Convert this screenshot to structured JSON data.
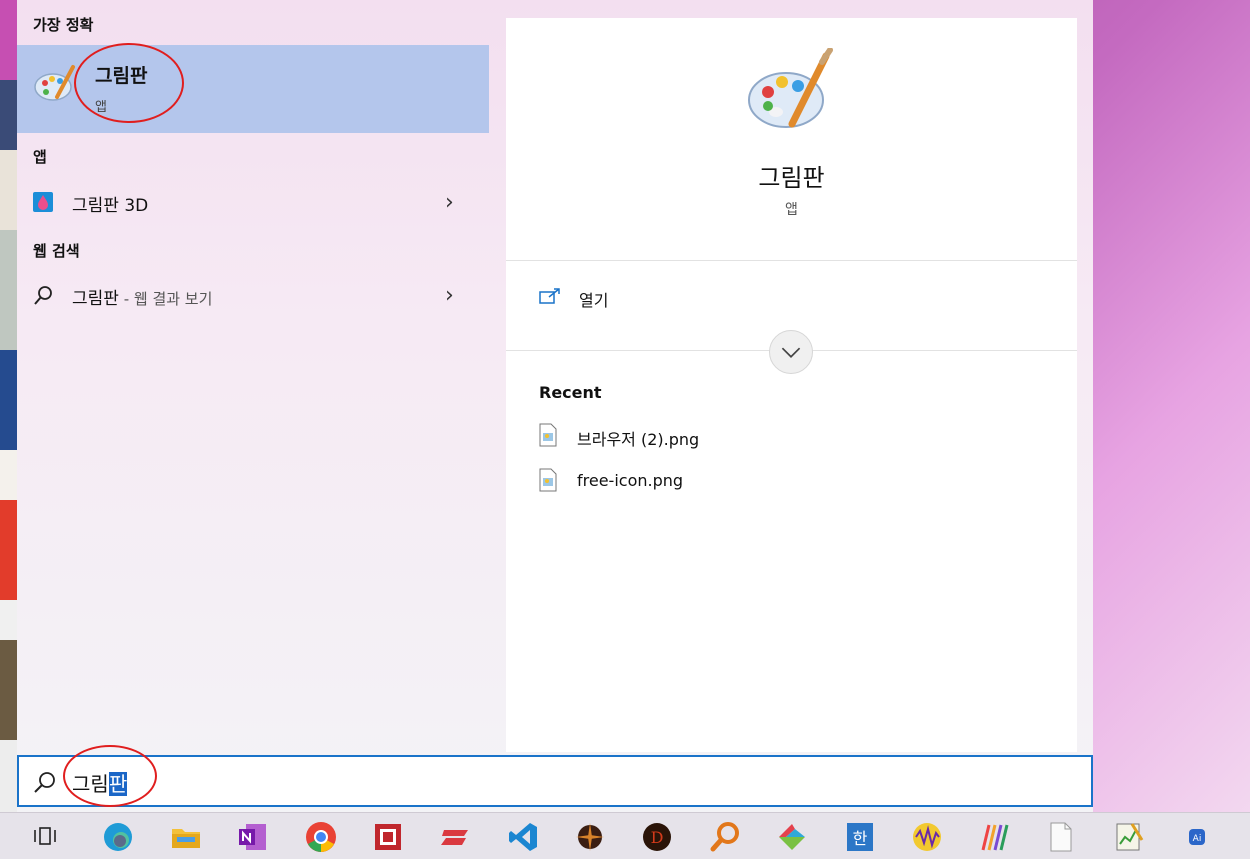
{
  "best_match": {
    "section_title": "가장 정확",
    "name": "그림판",
    "subtitle": "앱",
    "icon": "paint-palette-icon"
  },
  "apps": {
    "section_title": "앱",
    "items": [
      {
        "label": "그림판 3D",
        "icon": "paint-3d-icon"
      }
    ]
  },
  "web_search": {
    "section_title": "웹 검색",
    "query": "그림판",
    "suffix": " - 웹 결과 보기"
  },
  "preview": {
    "title": "그림판",
    "type": "앱",
    "open_label": "열기",
    "recent_title": "Recent",
    "recent_files": [
      "브라우저 (2).png",
      "free-icon.png"
    ]
  },
  "search": {
    "typed": "그림",
    "selected": "판"
  },
  "taskbar": {
    "icons": [
      "task-view-icon",
      "edge-icon",
      "file-explorer-icon",
      "onenote-icon",
      "chrome-icon",
      "screen-capture-icon",
      "express-vpn-icon",
      "vscode-icon",
      "game-d2-icon",
      "game-d-icon",
      "magnifier-icon",
      "colorful-app-icon",
      "hancom-icon",
      "audio-wave-icon",
      "pencil-lines-icon",
      "blank-document-icon",
      "notepad-chart-icon",
      "ai-app-icon"
    ]
  },
  "colors": {
    "accent": "#1a73c9",
    "highlight": "#b4c6ec",
    "annotation": "#e01e1e"
  }
}
